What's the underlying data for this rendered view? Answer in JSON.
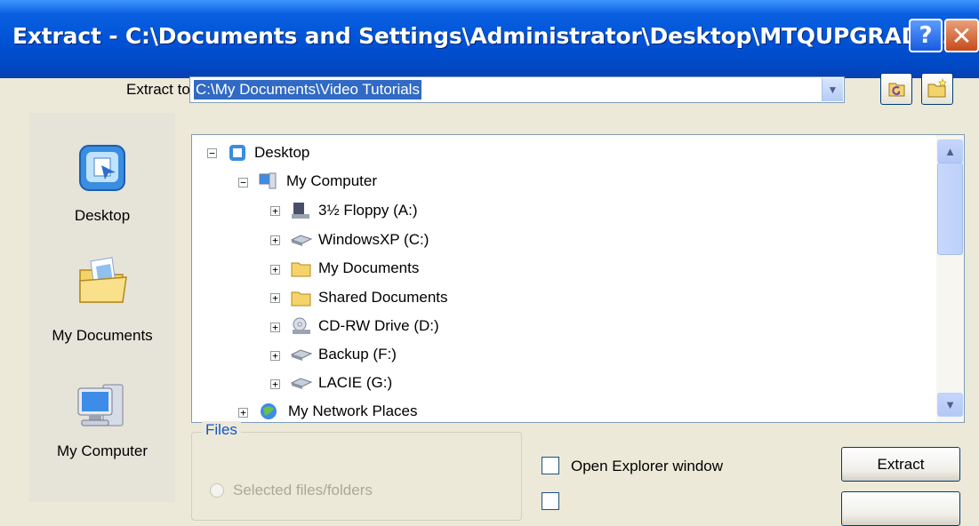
{
  "window": {
    "title": "Extract - C:\\Documents and Settings\\Administrator\\Desktop\\MTQUPGRADE.zip",
    "help_glyph": "?",
    "close_glyph": "✕"
  },
  "extract_to": {
    "label": "Extract to:",
    "value": "C:\\My Documents\\Video Tutorials",
    "dropdown_glyph": "▼"
  },
  "places": [
    {
      "label": "Desktop",
      "icon": "desktop-icon"
    },
    {
      "label": "My Documents",
      "icon": "my-documents-icon"
    },
    {
      "label": "My Computer",
      "icon": "my-computer-icon"
    }
  ],
  "tree": {
    "nodes": [
      {
        "label": "Desktop",
        "icon": "desktop-icon",
        "expander": "−"
      },
      {
        "label": "My Computer",
        "icon": "computer-icon",
        "expander": "−"
      },
      {
        "label": "3½ Floppy (A:)",
        "icon": "floppy-icon",
        "expander": "+"
      },
      {
        "label": "WindowsXP (C:)",
        "icon": "hard-drive-icon",
        "expander": "+"
      },
      {
        "label": "My Documents",
        "icon": "folder-icon",
        "expander": "+"
      },
      {
        "label": "Shared Documents",
        "icon": "folder-icon",
        "expander": "+"
      },
      {
        "label": "CD-RW Drive (D:)",
        "icon": "cd-drive-icon",
        "expander": "+"
      },
      {
        "label": "Backup (F:)",
        "icon": "hard-drive-icon",
        "expander": "+"
      },
      {
        "label": "LACIE (G:)",
        "icon": "hard-drive-icon",
        "expander": "+"
      },
      {
        "label": "My Network Places",
        "icon": "network-icon",
        "expander": "+"
      }
    ]
  },
  "scrollbar": {
    "up_glyph": "▲",
    "down_glyph": "▼"
  },
  "files_group": {
    "title": "Files",
    "option_selected": "Selected files/folders"
  },
  "options": {
    "open_explorer": "Open Explorer window"
  },
  "buttons": {
    "extract": "Extract"
  },
  "colors": {
    "titlebar": "#0053D6",
    "selection": "#316AC5",
    "dialog_bg": "#ECE9D8"
  }
}
